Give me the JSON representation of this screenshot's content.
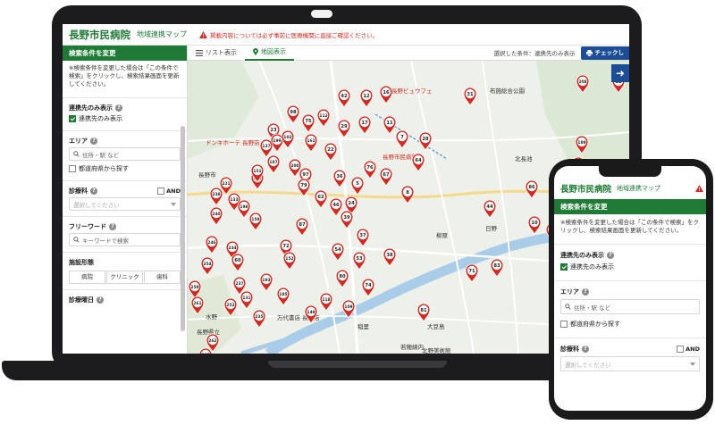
{
  "app": {
    "brand": "長野市民病院",
    "subtitle": "地域連携マップ",
    "notice": "掲載内容については必ず事前に医療機関に直接ご確認ください。"
  },
  "colors": {
    "brand_green": "#1e7a34",
    "accent_blue": "#1c4e98",
    "marker_red": "#d6281f"
  },
  "sidebar": {
    "header": "検索条件を変更",
    "note": "※検索条件を変更した場合は「この条件で検索」をクリックし、検索結果画面を更新してください。",
    "partner_label": "連携先のみ表示",
    "partner_check": "連携先のみ表示",
    "area_label": "エリア",
    "area_placeholder": "住所・駅 など",
    "other_pref": "都道府県から探す",
    "dept_label": "診療科",
    "and_label": "AND",
    "dept_placeholder": "選択してください",
    "freeword_label": "フリーワード",
    "freeword_placeholder": "キーワードで検索",
    "facility_label": "施設形態",
    "facility_types": [
      "病院",
      "クリニック",
      "歯科"
    ],
    "days_label": "診療曜日"
  },
  "tabs": {
    "list": "リスト表示",
    "map": "地図表示"
  },
  "toolbar": {
    "condition": "選択した条件：連携先のみ表示",
    "check_button": "チェックし"
  },
  "map": {
    "labels": [
      {
        "text": "長野ビュウフェ",
        "color": "#d6281f"
      },
      {
        "text": "布施総合公園",
        "color": "#333"
      },
      {
        "text": "ドンキホーテ 長野店",
        "color": "#d6281f"
      },
      {
        "text": "長野市民病院",
        "color": "#d6281f"
      },
      {
        "text": "長野市",
        "color": "#333"
      },
      {
        "text": "北長池",
        "color": "#333"
      },
      {
        "text": "柳原",
        "color": "#333"
      },
      {
        "text": "日野",
        "color": "#333"
      },
      {
        "text": "大豆島",
        "color": "#333"
      },
      {
        "text": "稲里",
        "color": "#333"
      },
      {
        "text": "若穂綿内",
        "color": "#333"
      },
      {
        "text": "北野美術館",
        "color": "#333"
      },
      {
        "text": "万代書店 長野店",
        "color": "#333"
      },
      {
        "text": "水野",
        "color": "#333"
      },
      {
        "text": "長野県立",
        "color": "#333"
      },
      {
        "text": "平林",
        "color": "#333"
      }
    ],
    "markers": [
      {
        "n": "208"
      },
      {
        "n": "32"
      },
      {
        "n": "42"
      },
      {
        "n": "16"
      },
      {
        "n": "12"
      },
      {
        "n": "31"
      },
      {
        "n": "98"
      },
      {
        "n": "75"
      },
      {
        "n": "112"
      },
      {
        "n": "23"
      },
      {
        "n": "29"
      },
      {
        "n": "17"
      },
      {
        "n": "11"
      },
      {
        "n": "199"
      },
      {
        "n": "102"
      },
      {
        "n": "137"
      },
      {
        "n": "187"
      },
      {
        "n": "161"
      },
      {
        "n": "7"
      },
      {
        "n": "28"
      },
      {
        "n": "22"
      },
      {
        "n": "153"
      },
      {
        "n": "200"
      },
      {
        "n": "97"
      },
      {
        "n": "76"
      },
      {
        "n": "67"
      },
      {
        "n": "64"
      },
      {
        "n": "221"
      },
      {
        "n": "151"
      },
      {
        "n": "36"
      },
      {
        "n": "79"
      },
      {
        "n": "5"
      },
      {
        "n": "238"
      },
      {
        "n": "133"
      },
      {
        "n": "198"
      },
      {
        "n": "62"
      },
      {
        "n": "46"
      },
      {
        "n": "24"
      },
      {
        "n": "8"
      },
      {
        "n": "39"
      },
      {
        "n": "240"
      },
      {
        "n": "159"
      },
      {
        "n": "87"
      },
      {
        "n": "37"
      },
      {
        "n": "44"
      },
      {
        "n": "246"
      },
      {
        "n": "234"
      },
      {
        "n": "72"
      },
      {
        "n": "54"
      },
      {
        "n": "254"
      },
      {
        "n": "60"
      },
      {
        "n": "152"
      },
      {
        "n": "53"
      },
      {
        "n": "38"
      },
      {
        "n": "259"
      },
      {
        "n": "237"
      },
      {
        "n": "193"
      },
      {
        "n": "80"
      },
      {
        "n": "74"
      },
      {
        "n": "71"
      },
      {
        "n": "83"
      },
      {
        "n": "261"
      },
      {
        "n": "252"
      },
      {
        "n": "131"
      },
      {
        "n": "185"
      },
      {
        "n": "118"
      },
      {
        "n": "109"
      },
      {
        "n": "81"
      },
      {
        "n": "149"
      },
      {
        "n": "235"
      },
      {
        "n": "262"
      },
      {
        "n": "265"
      },
      {
        "n": "189"
      },
      {
        "n": "164"
      },
      {
        "n": "86"
      },
      {
        "n": "10"
      },
      {
        "n": "210"
      },
      {
        "n": "167"
      },
      {
        "n": "146"
      },
      {
        "n": "258"
      },
      {
        "n": "163"
      }
    ]
  },
  "phone": {
    "brand": "長野市民病院",
    "subtitle": "地域連携マップ",
    "header": "検索条件を変更",
    "note": "※検索条件を変更した場合は「この条件で検索」をクリックし、検索結果画面を更新してください。",
    "partner_label": "連携先のみ表示",
    "partner_check": "連携先のみ表示",
    "area_label": "エリア",
    "area_placeholder": "住所・駅 など",
    "other_pref": "都道府県から探す",
    "dept_label": "診療科",
    "and_label": "AND",
    "dept_placeholder": "選択してください"
  }
}
